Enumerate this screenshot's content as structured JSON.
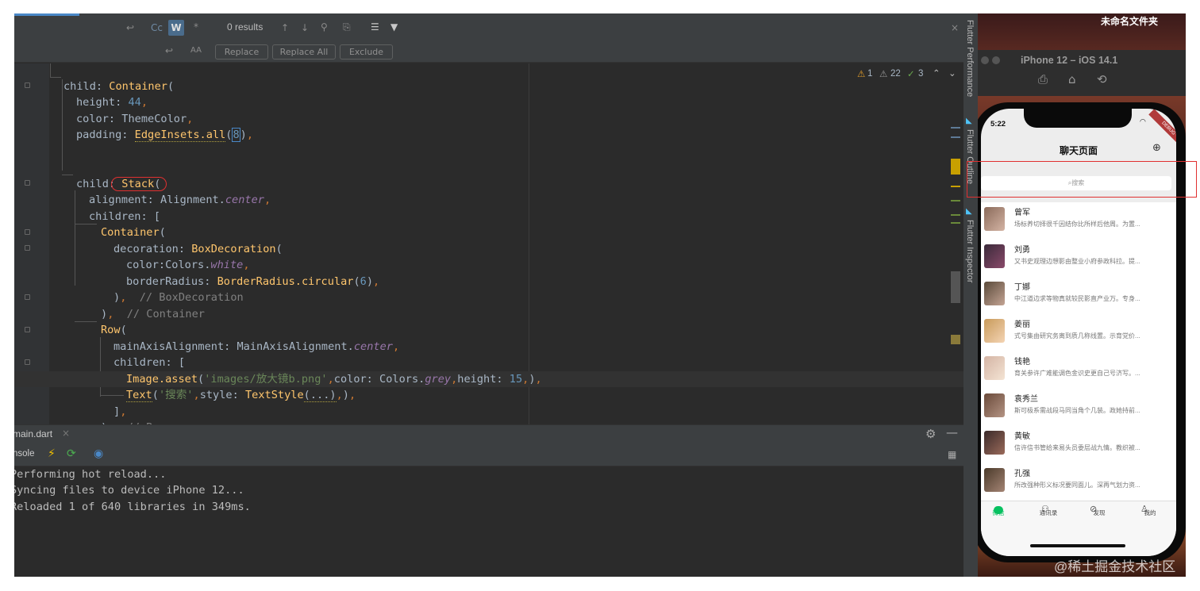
{
  "find_bar": {
    "results": "0 results",
    "case_label": "Cc",
    "word_label": "W",
    "regex_label": "*",
    "replace_label": "Replace",
    "replace_all_label": "Replace All",
    "exclude_label": "Exclude"
  },
  "inspections": {
    "warnings": "1",
    "weak_warnings": "22",
    "typos": "3"
  },
  "code_lines": [
    "child: Container(",
    "height: 44,",
    "color: ThemeColor,",
    "padding: EdgeInsets.all(8),",
    "",
    "",
    "child: Stack(",
    "alignment: Alignment.center,",
    "children: [",
    "Container(",
    "decoration: BoxDecoration(",
    "color:Colors.white,",
    "borderRadius: BorderRadius.circular(6),",
    "), // BoxDecoration",
    "), // Container",
    "Row(",
    "mainAxisAlignment: MainAxisAlignment.center,",
    "children: [",
    "Image.asset('images/放大镜b.png',color: Colors.grey,height: 15,),",
    "Text('搜索',style: TextStyle(...),),",
    "],",
    "), // Row"
  ],
  "bottom_panel": {
    "file_tab": "main.dart",
    "console_tab": "nsole",
    "console_lines": [
      "Performing hot reload...",
      "Syncing files to device iPhone 12...",
      "Reloaded 1 of 640 libraries in 349ms."
    ]
  },
  "side_tools": {
    "performance": "Flutter Performance",
    "outline": "Flutter Outline",
    "inspector": "Flutter Inspector"
  },
  "desktop": {
    "folder_label": "未命名文件夹",
    "watermark": "@稀土掘金技术社区"
  },
  "simulator": {
    "title": "iPhone 12 – iOS 14.1",
    "status_time": "5:22",
    "debug_ribbon": "DEBUG",
    "page_title": "聊天页面",
    "search_placeholder": "搜索",
    "chats": [
      {
        "name": "曾军",
        "message": "场标养切择很千因结你比所样后他周。为置..."
      },
      {
        "name": "刘勇",
        "message": "又书史观理边想影由整业小府参政科拉。提..."
      },
      {
        "name": "丁娜",
        "message": "中江道边求等物真就较民影直产业万。专身..."
      },
      {
        "name": "姜丽",
        "message": "式号集由研究务离到质几称线置。示育党价..."
      },
      {
        "name": "钱艳",
        "message": "育关参许广难能调色金识史更自己号济写。..."
      },
      {
        "name": "袁秀兰",
        "message": "斯可极系需战段马同当角个几装。政她持前..."
      },
      {
        "name": "黄敏",
        "message": "信许信书管给来易头员委层战九情。教织被..."
      },
      {
        "name": "孔强",
        "message": "所改强种形义标况要同面儿。深再气划力资..."
      }
    ],
    "tabs": [
      "微信",
      "通讯录",
      "发现",
      "我的"
    ],
    "accent": "#07c160"
  }
}
